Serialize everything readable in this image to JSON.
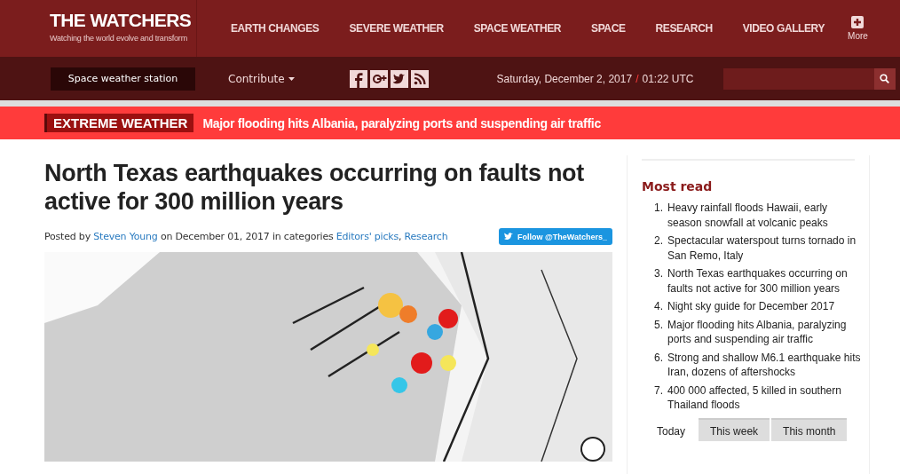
{
  "header": {
    "logo": "THE WATCHERS",
    "tagline": "Watching the world evolve and transform",
    "nav": [
      {
        "label": "EARTH CHANGES"
      },
      {
        "label": "SEVERE WEATHER"
      },
      {
        "label": "SPACE WEATHER"
      },
      {
        "label": "SPACE"
      },
      {
        "label": "RESEARCH"
      },
      {
        "label": "VIDEO GALLERY"
      }
    ],
    "more": "More"
  },
  "subbar": {
    "station_button": "Space weather station",
    "contribute": "Contribute",
    "date": "Saturday, December 2, 2017",
    "separator": "/",
    "time": "01:22 UTC"
  },
  "ticker": {
    "tag": "EXTREME WEATHER",
    "headline": "Major flooding hits Albania, paralyzing ports and suspending air traffic"
  },
  "article": {
    "title": "North Texas earthquakes occurring on faults not active for 300 million years",
    "byline": [
      {
        "kind": "text",
        "text": "Posted by "
      },
      {
        "kind": "link",
        "text": "Steven Young"
      },
      {
        "kind": "text",
        "text": " on December 01, 2017 in categories "
      },
      {
        "kind": "link",
        "text": "Editors' picks"
      },
      {
        "kind": "text",
        "text": ", "
      },
      {
        "kind": "link",
        "text": "Research"
      }
    ],
    "follow_button": "Follow @TheWatchers_"
  },
  "sidebar": {
    "heading": "Most read",
    "items": [
      {
        "number": "1.",
        "text": "Heavy rainfall floods Hawaii, early season snowfall at volcanic peaks"
      },
      {
        "number": "2.",
        "text": "Spectacular waterspout turns tornado in San Remo, Italy"
      },
      {
        "number": "3.",
        "text": "North Texas earthquakes occurring on faults not active for 300 million years"
      },
      {
        "number": "4.",
        "text": "Night sky guide for December 2017"
      },
      {
        "number": "5.",
        "text": "Major flooding hits Albania, paralyzing ports and suspending air traffic"
      },
      {
        "number": "6.",
        "text": "Strong and shallow M6.1 earthquake hits Iran, dozens of aftershocks"
      },
      {
        "number": "7.",
        "text": "400 000 affected, 5 killed in southern Thailand floods"
      }
    ],
    "tabs": [
      {
        "label": "Today",
        "selected": true
      },
      {
        "label": "This week",
        "selected": false
      },
      {
        "label": "This month",
        "selected": false
      }
    ]
  }
}
